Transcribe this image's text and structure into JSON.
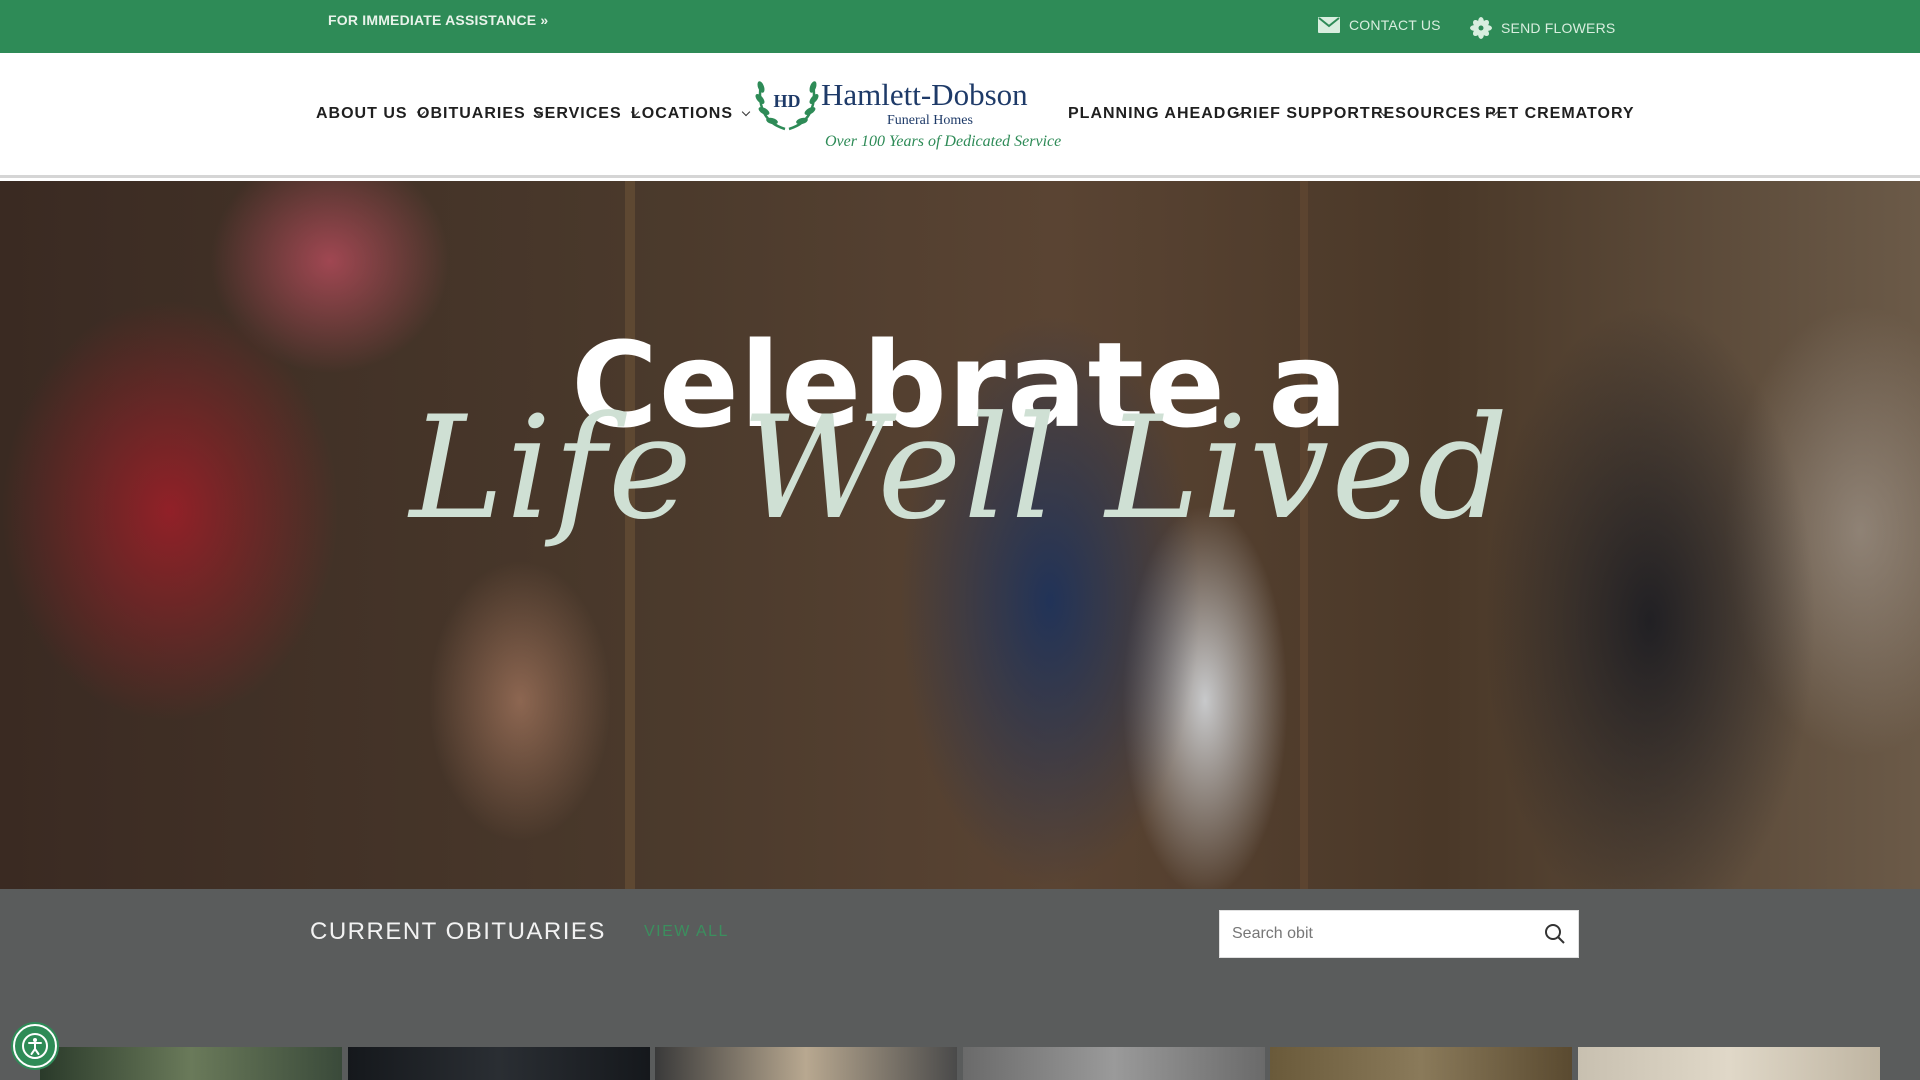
{
  "topbar": {
    "assistance": "FOR IMMEDIATE ASSISTANCE »",
    "contact": "CONTACT US",
    "flowers": "SEND FLOWERS"
  },
  "nav_left": [
    {
      "label": "ABOUT US",
      "dropdown": true
    },
    {
      "label": "OBITUARIES",
      "dropdown": true
    },
    {
      "label": "SERVICES",
      "dropdown": true
    },
    {
      "label": "LOCATIONS",
      "dropdown": true
    }
  ],
  "nav_right": [
    {
      "label": "PLANNING AHEAD",
      "dropdown": true
    },
    {
      "label": "GRIEF SUPPORT",
      "dropdown": true
    },
    {
      "label": "RESOURCES",
      "dropdown": true
    },
    {
      "label": "PET CREMATORY",
      "dropdown": false
    }
  ],
  "logo": {
    "monogram": "HD",
    "name": "Hamlett-Dobson",
    "subtitle": "Funeral Homes",
    "tagline": "Over 100 Years of Dedicated Service"
  },
  "hero": {
    "title": "Celebrate a",
    "script": "Life Well Lived"
  },
  "obituaries": {
    "heading": "CURRENT OBITUARIES",
    "view_all": "VIEW ALL",
    "search_placeholder": "Search obit"
  },
  "colors": {
    "brand_green": "#2e8b57",
    "navy": "#1e3a68",
    "section_gray": "#5a5c5c"
  }
}
